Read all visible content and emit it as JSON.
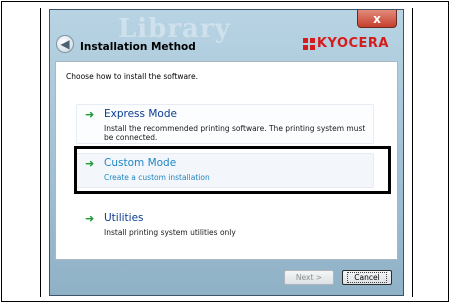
{
  "window": {
    "title": "Installation Method",
    "background_text": "Library",
    "close_label": "x",
    "back_label": "◀",
    "brand": "KYOCERA"
  },
  "content": {
    "prompt": "Choose how to install the software.",
    "options": [
      {
        "label": "Express Mode",
        "description": "Install the recommended printing software. The printing system must be connected."
      },
      {
        "label": "Custom Mode",
        "description": "Create a custom installation"
      },
      {
        "label": "Utilities",
        "description": "Install printing system utilities only"
      }
    ]
  },
  "footer": {
    "next_label": "Next >",
    "cancel_label": "Cancel"
  },
  "colors": {
    "accent": "#1f86c4",
    "arrow": "#1f9a36",
    "brand": "#d41c1c"
  }
}
